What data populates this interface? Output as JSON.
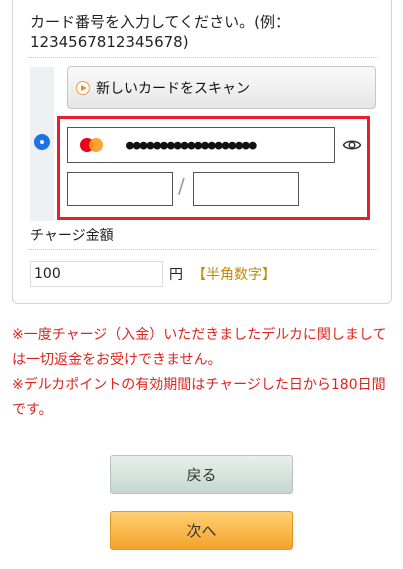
{
  "instruction": {
    "line1": "カード番号を入力してください。(例：",
    "line2": "1234567812345678)"
  },
  "scan_button": {
    "label": "新しいカードをスキャン"
  },
  "card": {
    "masked_number": "●●●●●●●●●●●●●●●●●●●",
    "brand_icon": "mastercard-icon",
    "reveal_icon": "eye-icon",
    "expiry_month": "",
    "expiry_year": "",
    "expiry_separator": "/"
  },
  "charge": {
    "label": "チャージ金額",
    "amount": "100",
    "unit": "円",
    "hint": "【半角数字】"
  },
  "notices": [
    "※一度チャージ（入金）いただきましたデルカに関しましては一切返金をお受けできません。",
    "※デルカポイントの有効期間はチャージした日から180日間です。"
  ],
  "buttons": {
    "back": "戻る",
    "next": "次へ"
  },
  "colors": {
    "highlight": "#e52229",
    "notice": "#e0231c",
    "radio": "#1a73e8",
    "next_button": "#f5a32a",
    "back_button": "#c7d6cf",
    "hint": "#c08a00"
  }
}
